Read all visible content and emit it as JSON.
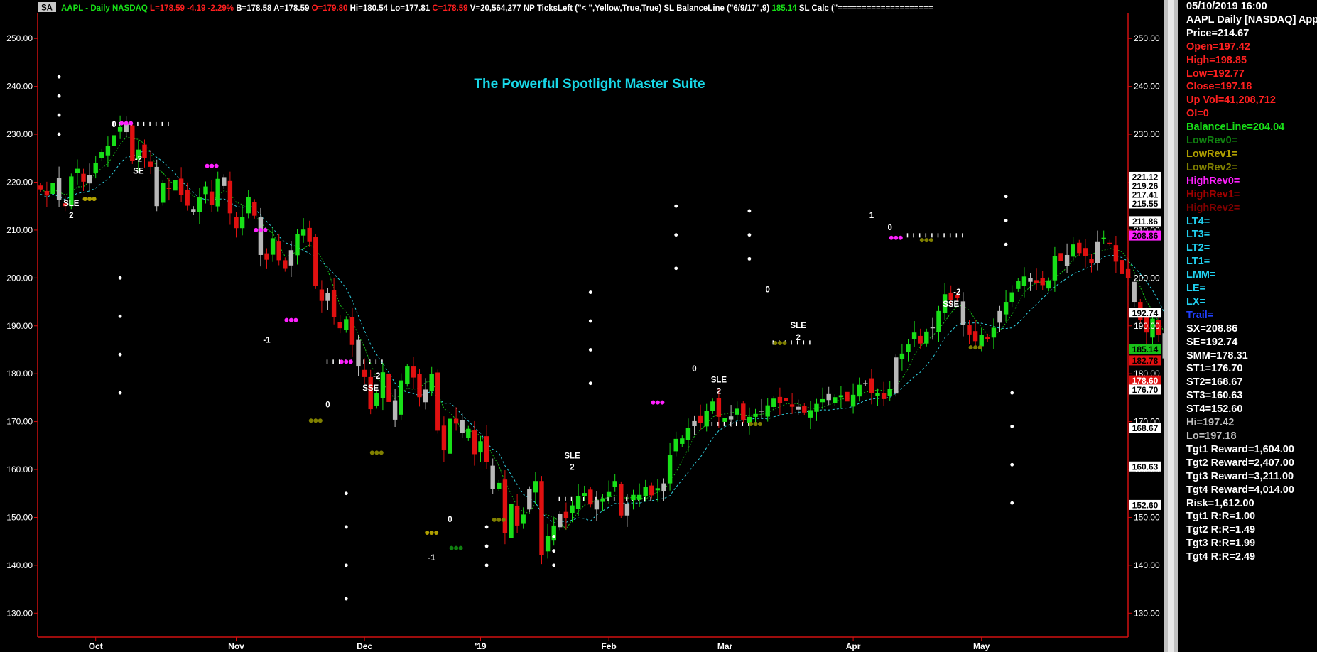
{
  "header": {
    "badge": "SA",
    "segments": [
      {
        "text": "AAPL - Daily  NASDAQ",
        "color": "#18e018"
      },
      {
        "text": "L=178.59",
        "color": "#ff2020"
      },
      {
        "text": "-4.19",
        "color": "#ff2020"
      },
      {
        "text": "-2.29%",
        "color": "#ff2020"
      },
      {
        "text": "B=178.58",
        "color": "#ffffff"
      },
      {
        "text": "A=178.59",
        "color": "#ffffff"
      },
      {
        "text": "O=179.80",
        "color": "#ff2020"
      },
      {
        "text": "Hi=180.54",
        "color": "#ffffff"
      },
      {
        "text": "Lo=177.81",
        "color": "#ffffff"
      },
      {
        "text": "C=178.59",
        "color": "#ff2020"
      },
      {
        "text": "V=20,564,277",
        "color": "#ffffff"
      },
      {
        "text": "NP  TicksLeft (\"< \",Yellow,True,True)",
        "color": "#ffffff"
      },
      {
        "text": "SL  BalanceLine (\"6/9/17\",9)",
        "color": "#ffffff"
      },
      {
        "text": "185.14",
        "color": "#18e018"
      },
      {
        "text": "SL  Calc (\"====================",
        "color": "#ffffff"
      }
    ]
  },
  "chart_title": "The Powerful Spotlight Master Suite",
  "chart_data": {
    "type": "candlestick",
    "symbol": "AAPL",
    "interval": "Daily",
    "exchange": "NASDAQ",
    "ylim": [
      125,
      253
    ],
    "y_ticks": [
      130,
      140,
      150,
      160,
      170,
      180,
      190,
      200,
      210,
      220,
      230,
      240,
      250
    ],
    "x_labels": [
      {
        "label": "Oct",
        "day": 9
      },
      {
        "label": "Nov",
        "day": 32
      },
      {
        "label": "Dec",
        "day": 53
      },
      {
        "label": "'19",
        "day": 72
      },
      {
        "label": "Feb",
        "day": 93
      },
      {
        "label": "Mar",
        "day": 112
      },
      {
        "label": "Apr",
        "day": 133
      },
      {
        "label": "May",
        "day": 154
      }
    ],
    "days": 175,
    "closes": [
      218.5,
      217.2,
      219.8,
      216.3,
      215.0,
      221.2,
      222.8,
      220.1,
      221.5,
      224.0,
      226.3,
      227.6,
      229.8,
      231.5,
      232.2,
      224.4,
      226.8,
      225.0,
      223.2,
      215.0,
      219.9,
      218.6,
      220.4,
      217.4,
      215.1,
      213.7,
      216.8,
      219.1,
      215.3,
      220.7,
      219.2,
      213.5,
      210.4,
      212.8,
      216.9,
      213.0,
      204.8,
      203.8,
      208.3,
      203.7,
      201.9,
      205.8,
      209.2,
      210.1,
      207.5,
      198.3,
      195.2,
      196.8,
      191.8,
      189.5,
      191.4,
      186.0,
      181.5,
      179.3,
      172.6,
      175.9,
      180.3,
      174.1,
      170.4,
      178.6,
      181.5,
      179.2,
      175.1,
      176.7,
      179.9,
      168.1,
      164.0,
      170.6,
      169.6,
      167.6,
      168.5,
      163.2,
      165.9,
      161.5,
      156.0,
      157.2,
      146.8,
      152.8,
      148.3,
      150.6,
      155.9,
      157.6,
      142.2,
      146.2,
      148.3,
      150.8,
      149.9,
      152.5,
      154.5,
      155.1,
      152.7,
      153.6,
      153.9,
      155.3,
      157.6,
      150.4,
      152.9,
      154.7,
      154.7,
      156.3,
      154.6,
      156.1,
      157.1,
      163.1,
      166.4,
      166.5,
      168.7,
      170.1,
      169.7,
      172.2,
      174.2,
      171.0,
      170.8,
      171.1,
      172.7,
      170.4,
      171.0,
      171.6,
      172.1,
      173.4,
      174.8,
      173.8,
      174.3,
      173.1,
      172.5,
      171.9,
      172.4,
      173.7,
      174.7,
      174.5,
      175.1,
      175.5,
      174.2,
      175.6,
      177.7,
      178.0,
      176.0,
      175.9,
      174.7,
      176.9,
      183.4,
      184.2,
      186.1,
      188.6,
      186.3,
      188.8,
      189.7,
      193.1,
      196.6,
      195.4,
      195.8,
      190.2,
      188.2,
      186.8,
      188.1,
      187.2,
      189.6,
      193.1,
      195.0,
      197.0,
      199.4,
      200.3,
      199.2,
      198.9,
      198.5,
      199.5,
      204.5,
      203.6,
      204.8,
      207.0,
      205.2,
      204.6,
      203.1,
      207.5,
      208.4,
      207.2,
      203.4,
      200.8,
      199.9,
      195.0,
      191.2,
      188.6,
      191.5,
      188.1,
      183.2,
      178.6
    ],
    "series": [
      {
        "name": "BalanceLine",
        "color": "#18c018",
        "style": "dotted"
      },
      {
        "name": "Trend",
        "color": "#30d0e0",
        "style": "dashed"
      }
    ],
    "price_tags": [
      {
        "value": 221.12,
        "label": "221.12",
        "bg": "#ffffff",
        "fg": "#000000"
      },
      {
        "value": 219.26,
        "label": "219.26",
        "bg": "#ffffff",
        "fg": "#000000"
      },
      {
        "value": 217.41,
        "label": "217.41",
        "bg": "#ffffff",
        "fg": "#000000"
      },
      {
        "value": 215.55,
        "label": "215.55",
        "bg": "#ffffff",
        "fg": "#000000"
      },
      {
        "value": 211.86,
        "label": "211.86",
        "bg": "#ffffff",
        "fg": "#000000"
      },
      {
        "value": 208.86,
        "label": "208.86",
        "bg": "#ff20ff",
        "fg": "#000000"
      },
      {
        "value": 192.74,
        "label": "192.74",
        "bg": "#ffffff",
        "fg": "#000000"
      },
      {
        "value": 185.14,
        "label": "185.14",
        "bg": "#18c018",
        "fg": "#000000"
      },
      {
        "value": 182.78,
        "label": "182.78",
        "bg": "#e01010",
        "fg": "#000000"
      },
      {
        "value": 178.6,
        "label": "178.60",
        "bg": "#e01010",
        "fg": "#ffffff"
      },
      {
        "value": 176.7,
        "label": "176.70",
        "bg": "#ffffff",
        "fg": "#000000"
      },
      {
        "value": 168.67,
        "label": "168.67",
        "bg": "#ffffff",
        "fg": "#000000"
      },
      {
        "value": 160.63,
        "label": "160.63",
        "bg": "#ffffff",
        "fg": "#000000"
      },
      {
        "value": 152.6,
        "label": "152.60",
        "bg": "#ffffff",
        "fg": "#000000"
      }
    ],
    "signal_labels": [
      {
        "text": "0",
        "day": 12,
        "value": 231.5
      },
      {
        "text": "-2",
        "day": 16,
        "value": 224.3
      },
      {
        "text": "SE",
        "day": 16,
        "value": 221.8
      },
      {
        "text": "SLE",
        "day": 5,
        "value": 215.0
      },
      {
        "text": "2",
        "day": 5,
        "value": 212.5
      },
      {
        "text": "-1",
        "day": 37,
        "value": 186.5
      },
      {
        "text": "0",
        "day": 47,
        "value": 173.0
      },
      {
        "text": "-2",
        "day": 55,
        "value": 179.0
      },
      {
        "text": "SSE",
        "day": 54,
        "value": 176.5
      },
      {
        "text": "-1",
        "day": 64,
        "value": 141.0
      },
      {
        "text": "0",
        "day": 67,
        "value": 149.0
      },
      {
        "text": "SLE",
        "day": 87,
        "value": 162.3
      },
      {
        "text": "2",
        "day": 87,
        "value": 159.9
      },
      {
        "text": "0",
        "day": 107,
        "value": 180.5
      },
      {
        "text": "SLE",
        "day": 111,
        "value": 178.2
      },
      {
        "text": "2",
        "day": 111,
        "value": 175.8
      },
      {
        "text": "0",
        "day": 119,
        "value": 197.0
      },
      {
        "text": "SLE",
        "day": 124,
        "value": 189.5
      },
      {
        "text": "2",
        "day": 124,
        "value": 187.0
      },
      {
        "text": "1",
        "day": 136,
        "value": 212.5
      },
      {
        "text": "0",
        "day": 139,
        "value": 210.0
      },
      {
        "text": "-2",
        "day": 150,
        "value": 196.5
      },
      {
        "text": "SSE",
        "day": 149,
        "value": 194.0
      }
    ]
  },
  "data_window": {
    "lines": [
      {
        "text": "05/10/2019 16:00",
        "color": "#ffffff"
      },
      {
        "text": "AAPL Daily [NASDAQ] Apple",
        "color": "#ffffff"
      },
      {
        "text": "Price=214.67",
        "color": "#ffffff"
      },
      {
        "text": "Open=197.42",
        "color": "#ff2020"
      },
      {
        "text": "High=198.85",
        "color": "#ff2020"
      },
      {
        "text": "Low=192.77",
        "color": "#ff2020"
      },
      {
        "text": "Close=197.18",
        "color": "#ff2020"
      },
      {
        "text": "Up Vol=41,208,712",
        "color": "#ff2020"
      },
      {
        "text": "OI=0",
        "color": "#ff2020"
      },
      {
        "text": "BalanceLine=204.04",
        "color": "#18e018"
      },
      {
        "text": "LowRev0=",
        "color": "#108010"
      },
      {
        "text": "LowRev1=",
        "color": "#b0a000"
      },
      {
        "text": "LowRev2=",
        "color": "#808000"
      },
      {
        "text": "HighRev0=",
        "color": "#ff20ff"
      },
      {
        "text": "HighRev1=",
        "color": "#a00000"
      },
      {
        "text": "HighRev2=",
        "color": "#800000"
      },
      {
        "text": "LT4=",
        "color": "#20d0f0"
      },
      {
        "text": "LT3=",
        "color": "#20d0f0"
      },
      {
        "text": "LT2=",
        "color": "#20d0f0"
      },
      {
        "text": "LT1=",
        "color": "#20d0f0"
      },
      {
        "text": "LMM=",
        "color": "#20d0f0"
      },
      {
        "text": "LE=",
        "color": "#20d0f0"
      },
      {
        "text": "LX=",
        "color": "#20d0f0"
      },
      {
        "text": "Trail=",
        "color": "#2040ff"
      },
      {
        "text": "SX=208.86",
        "color": "#ffffff"
      },
      {
        "text": "SE=192.74",
        "color": "#ffffff"
      },
      {
        "text": "SMM=178.31",
        "color": "#ffffff"
      },
      {
        "text": "ST1=176.70",
        "color": "#ffffff"
      },
      {
        "text": "ST2=168.67",
        "color": "#ffffff"
      },
      {
        "text": "ST3=160.63",
        "color": "#ffffff"
      },
      {
        "text": "ST4=152.60",
        "color": "#ffffff"
      },
      {
        "text": "Hi=197.42",
        "color": "#c0c0c0"
      },
      {
        "text": "Lo=197.18",
        "color": "#c0c0c0"
      },
      {
        "text": "Tgt1 Reward=1,604.00",
        "color": "#ffffff"
      },
      {
        "text": "Tgt2 Reward=2,407.00",
        "color": "#ffffff"
      },
      {
        "text": "Tgt3 Reward=3,211.00",
        "color": "#ffffff"
      },
      {
        "text": "Tgt4 Reward=4,014.00",
        "color": "#ffffff"
      },
      {
        "text": "Risk=1,612.00",
        "color": "#ffffff"
      },
      {
        "text": "Tgt1 R:R=1.00",
        "color": "#ffffff"
      },
      {
        "text": "Tgt2 R:R=1.49",
        "color": "#ffffff"
      },
      {
        "text": "Tgt3 R:R=1.99",
        "color": "#ffffff"
      },
      {
        "text": "Tgt4 R:R=2.49",
        "color": "#ffffff"
      }
    ]
  }
}
